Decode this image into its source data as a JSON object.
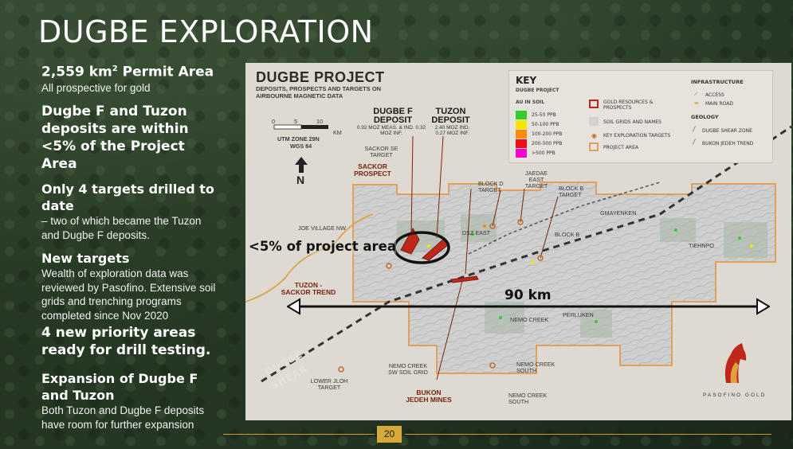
{
  "slide": {
    "title": "DUGBE EXPLORATION",
    "page_number": "20"
  },
  "left": {
    "permit_title_pre": "2,559 km",
    "permit_title_sup": "2",
    "permit_title_post": " Permit Area",
    "permit_sub": "All prospective for gold",
    "deposits_heading": "Dugbe F and Tuzon deposits are within <5% of the Project Area",
    "targets_heading": "Only 4 targets drilled to date",
    "targets_body": "– two of which became the Tuzon and Dugbe F deposits.",
    "new_targets_heading": "New targets",
    "new_targets_body": "Wealth of exploration data was reviewed by Pasofino. Extensive soil grids and trenching programs completed since Nov 2020",
    "priority_heading": "4 new priority areas ready for drill testing.",
    "expansion_heading": "Expansion of Dugbe F and Tuzon",
    "expansion_body": "Both Tuzon and Dugbe F deposits have room for further expansion"
  },
  "map": {
    "title": "DUGBE PROJECT",
    "subtitle": "DEPOSITS, PROSPECTS AND TARGETS ON AIRBOURNE MAGNETIC DATA",
    "scale_ticks": [
      "0",
      "5",
      "10"
    ],
    "scale_unit": "km",
    "utm": "UTM ZONE 29N",
    "datum": "WGS 84",
    "north": "N",
    "dugbe_f_title": "DUGBE F DEPOSIT",
    "dugbe_f_sub": "0.92 MOZ MEAS. & IND. 0.32 MOZ INF.",
    "tuzon_title": "TUZON DEPOSIT",
    "tuzon_sub": "2.40 MOZ IND. 0.27 MOZ INF.",
    "sackor_se": "SACKOR SE TARGET",
    "sackor_prospect": "SACKOR PROSPECT",
    "block_d": "BLOCK D TARGET",
    "jaedae": "JAEDAE EAST TARGET",
    "block_b_target": "BLOCK B TARGET",
    "gmayenken": "GMAYENKEN",
    "block_b": "BLOCK B",
    "tiehnpo": "TIEHNPO",
    "joe_village": "JOE VILLAGE NW",
    "dsz_east": "DSZ EAST",
    "tuzon_sackor": "TUZON -SACKOR TREND",
    "nemo_creek": "NEMO CREEK",
    "perluken": "PERLUKEN",
    "nemo_sw": "NEMO CREEK SW SOIL GRID",
    "nemo_south": "NEMO CREEK SOUTH",
    "nemo_south2": "NEMO CREEK SOUTH",
    "lower_jloh": "LOWER JLOH TARGET",
    "bukon_jedeh": "BUKON JEDEH MINES",
    "dugbe_shear_1": "DUGBE",
    "dugbe_shear_2": "SHEAR",
    "pasofino": "PASOFINO GOLD",
    "five_pct": "<5% of project area",
    "span": "90 km"
  },
  "key": {
    "title": "KEY",
    "subtitle": "DUGBE PROJECT",
    "au_heading": "AU IN SOIL",
    "au_bins": [
      {
        "label": "25-50 PPB",
        "color": "#33cc33"
      },
      {
        "label": "50-100 PPB",
        "color": "#f5e600"
      },
      {
        "label": "100-200 PPB",
        "color": "#ff8c00"
      },
      {
        "label": "200-500 PPB",
        "color": "#ee1111"
      },
      {
        "label": ">500 PPB",
        "color": "#ff00cc"
      }
    ],
    "gold_resources": "GOLD RESOURCES & PROSPECTS",
    "soil_grids": "SOIL GRIDS AND NAMES",
    "key_targets": "KEY EXPLORATION TARGETS",
    "project_area": "PROJECT AREA",
    "infrastructure": "INFRASTRUCTURE",
    "access": "ACCESS",
    "main_road": "MAIN ROAD",
    "geology": "GEOLOGY",
    "dugbe_shear_zone": "DUGBE SHEAR ZONE",
    "bukon_trend": "BUKON JEDEH TREND"
  },
  "colors": {
    "accent_gold": "#d7a93a",
    "project_outline": "#e0a060",
    "deposit_red": "#c0271b"
  }
}
